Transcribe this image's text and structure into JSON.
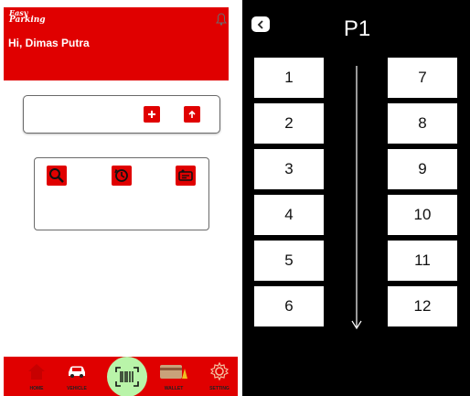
{
  "home": {
    "logo_line1": "Easy",
    "logo_line2": "Parking",
    "greeting": "Hi, Dimas Putra",
    "nav": {
      "home": "HOME",
      "vehicle": "VEHICLE",
      "wallet": "WALLET",
      "setting": "SETTING"
    },
    "icons": [
      "bell-icon",
      "plus-icon",
      "upload-icon",
      "search-icon",
      "history-icon",
      "ticket-icon",
      "home-icon",
      "car-icon",
      "barcode-icon",
      "wallet-icon",
      "gear-icon"
    ]
  },
  "parking": {
    "title": "P1",
    "left_slots": [
      "1",
      "2",
      "3",
      "4",
      "5",
      "6"
    ],
    "right_slots": [
      "7",
      "8",
      "9",
      "10",
      "11",
      "12"
    ],
    "icons": [
      "back-icon",
      "down-arrow-icon"
    ]
  },
  "colors": {
    "primary_red": "#e00000",
    "scan_green": "#b9f4a9",
    "parking_bg": "#000000"
  }
}
